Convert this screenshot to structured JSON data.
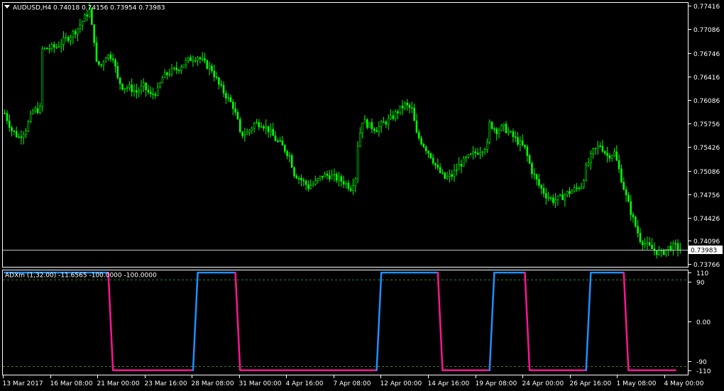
{
  "header": {
    "symbol": "AUDUSD,H4",
    "ohlc": "0.74018 0.74156 0.73954 0.73983",
    "menu_icon": "triangle-down-icon"
  },
  "indicator_header": "ADXm (1,32.00) -11.6565 -100.0000 -100.0000",
  "current_price_label": "0.73983",
  "colors": {
    "background": "#000000",
    "candle": "#00ff00",
    "grid_frame": "#ffffff",
    "price_line": "#c0c0c0",
    "level_line": "#2e7d32",
    "adx_up": "#1e90ff",
    "adx_down": "#ff1493"
  },
  "chart_data": [
    {
      "type": "candlestick",
      "title": "AUDUSD,H4",
      "y_ticks": [
        "0.77416",
        "0.77086",
        "0.76746",
        "0.76416",
        "0.76086",
        "0.75756",
        "0.75426",
        "0.75086",
        "0.74756",
        "0.74426",
        "0.74096",
        "0.73766"
      ],
      "ylim": [
        0.7373,
        0.7745
      ],
      "x_ticks": [
        "13 Mar 2017",
        "16 Mar 08:00",
        "21 Mar 00:00",
        "23 Mar 16:00",
        "28 Mar 08:00",
        "31 Mar 00:00",
        "4 Apr 16:00",
        "7 Apr 08:00",
        "12 Apr 00:00",
        "14 Apr 16:00",
        "19 Apr 08:00",
        "24 Apr 00:00",
        "26 Apr 16:00",
        "1 May 08:00",
        "4 May 00:00"
      ],
      "close_profile": [
        [
          0,
          0.759
        ],
        [
          3,
          0.7566
        ],
        [
          6,
          0.7556
        ],
        [
          9,
          0.7568
        ],
        [
          12,
          0.7593
        ],
        [
          15,
          0.7596
        ],
        [
          16,
          0.768
        ],
        [
          19,
          0.7682
        ],
        [
          22,
          0.7684
        ],
        [
          25,
          0.7692
        ],
        [
          28,
          0.77
        ],
        [
          31,
          0.771
        ],
        [
          34,
          0.7725
        ],
        [
          36,
          0.7736
        ],
        [
          37,
          0.7712
        ],
        [
          38,
          0.7694
        ],
        [
          39,
          0.766
        ],
        [
          41,
          0.7658
        ],
        [
          43,
          0.7672
        ],
        [
          46,
          0.767
        ],
        [
          48,
          0.7638
        ],
        [
          50,
          0.7628
        ],
        [
          53,
          0.7626
        ],
        [
          56,
          0.762
        ],
        [
          59,
          0.7628
        ],
        [
          62,
          0.7615
        ],
        [
          65,
          0.7622
        ],
        [
          67,
          0.764
        ],
        [
          70,
          0.7648
        ],
        [
          73,
          0.7652
        ],
        [
          76,
          0.766
        ],
        [
          79,
          0.7667
        ],
        [
          82,
          0.767
        ],
        [
          85,
          0.766
        ],
        [
          88,
          0.7652
        ],
        [
          91,
          0.763
        ],
        [
          94,
          0.7615
        ],
        [
          97,
          0.76
        ],
        [
          99,
          0.7578
        ],
        [
          100,
          0.756
        ],
        [
          103,
          0.7562
        ],
        [
          106,
          0.7575
        ],
        [
          109,
          0.7576
        ],
        [
          112,
          0.7567
        ],
        [
          115,
          0.7553
        ],
        [
          118,
          0.7543
        ],
        [
          121,
          0.753
        ],
        [
          123,
          0.7505
        ],
        [
          126,
          0.7496
        ],
        [
          129,
          0.7486
        ],
        [
          132,
          0.7492
        ],
        [
          135,
          0.7502
        ],
        [
          138,
          0.7502
        ],
        [
          141,
          0.7498
        ],
        [
          144,
          0.7493
        ],
        [
          147,
          0.7485
        ],
        [
          149,
          0.75
        ],
        [
          150,
          0.7546
        ],
        [
          152,
          0.758
        ],
        [
          155,
          0.7572
        ],
        [
          158,
          0.7568
        ],
        [
          161,
          0.7576
        ],
        [
          164,
          0.7582
        ],
        [
          167,
          0.7593
        ],
        [
          170,
          0.7602
        ],
        [
          173,
          0.7595
        ],
        [
          175,
          0.756
        ],
        [
          178,
          0.7545
        ],
        [
          181,
          0.753
        ],
        [
          184,
          0.751
        ],
        [
          187,
          0.7498
        ],
        [
          190,
          0.7502
        ],
        [
          193,
          0.7516
        ],
        [
          196,
          0.7525
        ],
        [
          199,
          0.7532
        ],
        [
          202,
          0.7538
        ],
        [
          205,
          0.7545
        ],
        [
          206,
          0.7575
        ],
        [
          209,
          0.7566
        ],
        [
          212,
          0.757
        ],
        [
          215,
          0.756
        ],
        [
          218,
          0.755
        ],
        [
          221,
          0.754
        ],
        [
          224,
          0.7508
        ],
        [
          227,
          0.7488
        ],
        [
          230,
          0.7474
        ],
        [
          233,
          0.7467
        ],
        [
          236,
          0.747
        ],
        [
          239,
          0.7477
        ],
        [
          242,
          0.7482
        ],
        [
          245,
          0.7488
        ],
        [
          247,
          0.7512
        ],
        [
          250,
          0.7536
        ],
        [
          253,
          0.7545
        ],
        [
          256,
          0.753
        ],
        [
          259,
          0.7534
        ],
        [
          261,
          0.751
        ],
        [
          264,
          0.7472
        ],
        [
          267,
          0.744
        ],
        [
          270,
          0.7412
        ],
        [
          273,
          0.7403
        ],
        [
          276,
          0.7396
        ],
        [
          279,
          0.7392
        ],
        [
          282,
          0.74
        ],
        [
          285,
          0.7402
        ],
        [
          287,
          0.7398
        ]
      ]
    },
    {
      "type": "line",
      "title": "ADXm (1,32.00)",
      "y_ticks": [
        "110",
        "90",
        "0.00",
        "-90",
        "-110"
      ],
      "levels": [
        90,
        -90
      ],
      "ylim": [
        -120,
        115
      ],
      "x_range": [
        0,
        287
      ],
      "series": [
        {
          "values": [
            [
              0,
              110
            ],
            [
              44,
              110
            ],
            [
              46,
              -110
            ],
            [
              80,
              -110
            ],
            [
              82,
              110
            ],
            [
              98,
              110
            ],
            [
              100,
              -110
            ],
            [
              158,
              -110
            ],
            [
              160,
              110
            ],
            [
              184,
              110
            ],
            [
              186,
              -110
            ],
            [
              206,
              -110
            ],
            [
              208,
              110
            ],
            [
              221,
              110
            ],
            [
              223,
              -110
            ],
            [
              247,
              -110
            ],
            [
              249,
              110
            ],
            [
              263,
              110
            ],
            [
              265,
              -110
            ],
            [
              285,
              -110
            ]
          ]
        }
      ]
    }
  ]
}
